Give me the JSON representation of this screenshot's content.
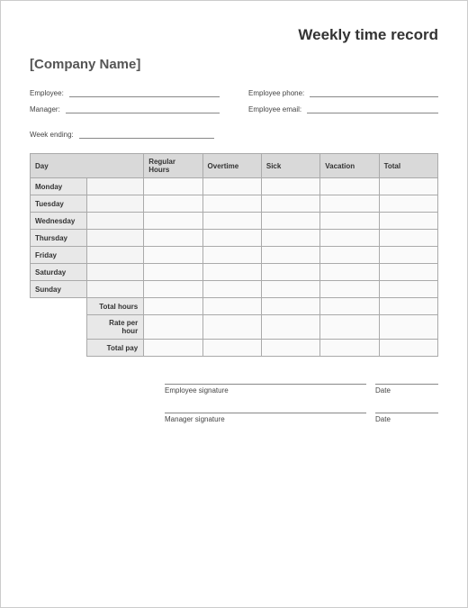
{
  "title": "Weekly time record",
  "company": "[Company Name]",
  "info": {
    "employee_label": "Employee:",
    "manager_label": "Manager:",
    "phone_label": "Employee phone:",
    "email_label": "Employee email:",
    "week_ending_label": "Week ending:"
  },
  "table": {
    "headers": {
      "day": "Day",
      "regular": "Regular Hours",
      "overtime": "Overtime",
      "sick": "Sick",
      "vacation": "Vacation",
      "total": "Total"
    },
    "days": [
      "Monday",
      "Tuesday",
      "Wednesday",
      "Thursday",
      "Friday",
      "Saturday",
      "Sunday"
    ],
    "summary": {
      "total_hours": "Total hours",
      "rate": "Rate per hour",
      "total_pay": "Total pay"
    }
  },
  "signatures": {
    "employee": "Employee signature",
    "manager": "Manager signature",
    "date": "Date"
  }
}
